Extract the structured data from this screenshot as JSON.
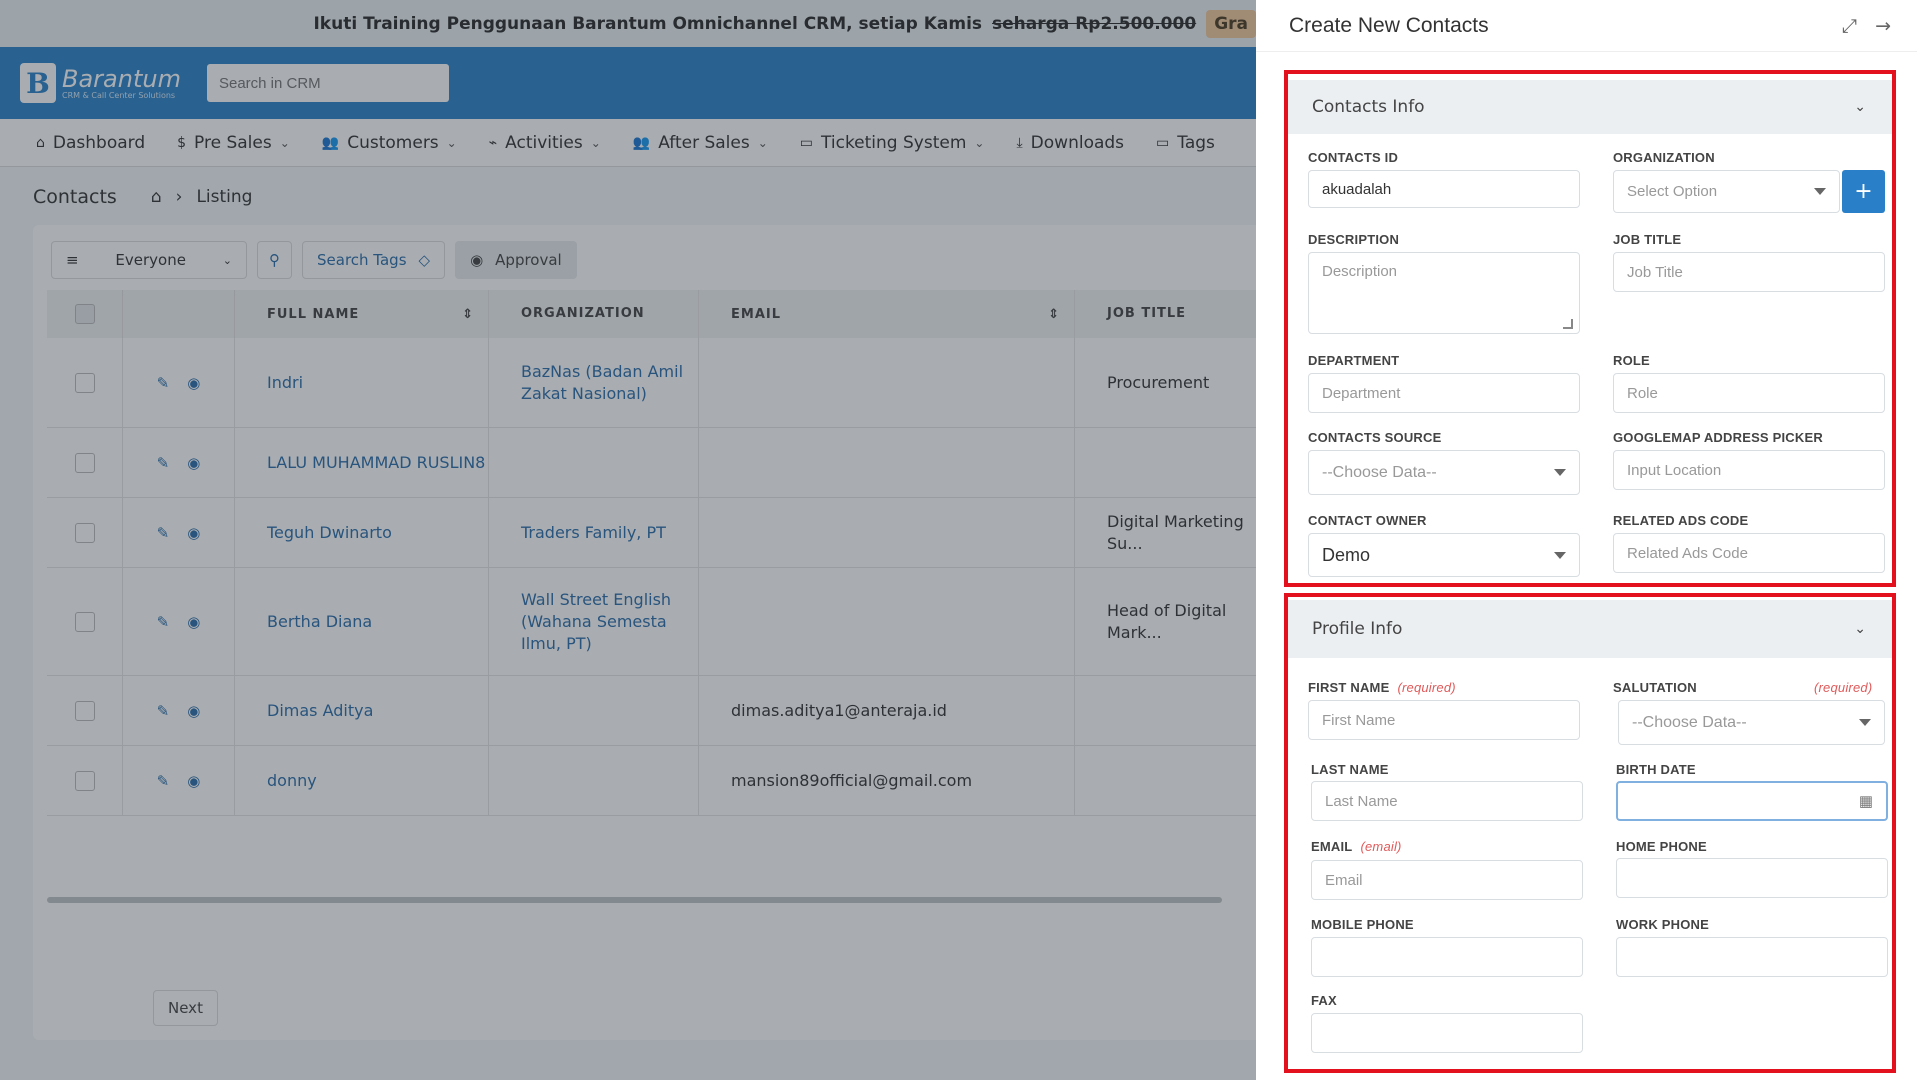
{
  "banner": {
    "text": "Ikuti Training Penggunaan Barantum Omnichannel CRM, setiap Kamis",
    "strike": "seharga Rp2.500.000",
    "badge": "Gra"
  },
  "header": {
    "brand": "Barantum",
    "tagline": "CRM & Call Center Solutions",
    "search_placeholder": "Search in CRM"
  },
  "nav": [
    {
      "label": "Dashboard",
      "icon": "home-icon",
      "glyph": "⌂",
      "chevron": false
    },
    {
      "label": "Pre Sales",
      "icon": "dollar-icon",
      "glyph": "$",
      "chevron": true
    },
    {
      "label": "Customers",
      "icon": "users-icon",
      "glyph": "👥",
      "chevron": true
    },
    {
      "label": "Activities",
      "icon": "activity-icon",
      "glyph": "⌁",
      "chevron": true
    },
    {
      "label": "After Sales",
      "icon": "users-icon",
      "glyph": "👥",
      "chevron": true
    },
    {
      "label": "Ticketing System",
      "icon": "folder-icon",
      "glyph": "▭",
      "chevron": true
    },
    {
      "label": "Downloads",
      "icon": "download-icon",
      "glyph": "⤓",
      "chevron": false
    },
    {
      "label": "Tags",
      "icon": "folder-icon",
      "glyph": "▭",
      "chevron": false
    }
  ],
  "breadcrumb": {
    "title": "Contacts",
    "sep": "›",
    "page": "Listing"
  },
  "toolbar": {
    "filter": "Everyone",
    "search_tags": "Search Tags",
    "approval": "Approval"
  },
  "table": {
    "headers": [
      "FULL NAME",
      "ORGANIZATION",
      "EMAIL",
      "JOB TITLE"
    ],
    "rows": [
      {
        "name": "Indri",
        "org": "BazNas (Badan Amil Zakat Nasional)",
        "email": "",
        "job": "Procurement"
      },
      {
        "name": "LALU MUHAMMAD RUSLIN8",
        "org": "",
        "email": "",
        "job": ""
      },
      {
        "name": "Teguh Dwinarto",
        "org": "Traders Family, PT",
        "email": "",
        "job": "Digital Marketing Su..."
      },
      {
        "name": "Bertha Diana",
        "org": "Wall Street English (Wahana Semesta Ilmu, PT)",
        "email": "",
        "job": "Head of Digital Mark..."
      },
      {
        "name": "Dimas Aditya",
        "org": "",
        "email": "dimas.aditya1@anteraja.id",
        "job": ""
      },
      {
        "name": "donny",
        "org": "",
        "email": "mansion89official@gmail.com",
        "job": ""
      }
    ]
  },
  "pager": {
    "next": "Next"
  },
  "panel": {
    "title": "Create New Contacts",
    "contacts_info": {
      "heading": "Contacts Info",
      "contacts_id_label": "CONTACTS ID",
      "contacts_id_value": "akuadalah",
      "organization_label": "ORGANIZATION",
      "organization_placeholder": "Select Option",
      "description_label": "DESCRIPTION",
      "description_placeholder": "Description",
      "job_title_label": "JOB TITLE",
      "job_title_placeholder": "Job Title",
      "department_label": "DEPARTMENT",
      "department_placeholder": "Department",
      "role_label": "ROLE",
      "role_placeholder": "Role",
      "contacts_source_label": "CONTACTS SOURCE",
      "contacts_source_value": "--Choose Data--",
      "googlemap_label": "GOOGLEMAP ADDRESS PICKER",
      "googlemap_placeholder": "Input Location",
      "contact_owner_label": "CONTACT OWNER",
      "contact_owner_value": "Demo",
      "related_ads_label": "RELATED ADS CODE",
      "related_ads_placeholder": "Related Ads Code"
    },
    "profile_info": {
      "heading": "Profile Info",
      "first_name_label": "FIRST NAME",
      "first_name_req": "(required)",
      "first_name_placeholder": "First Name",
      "salutation_label": "SALUTATION",
      "salutation_req": "(required)",
      "salutation_value": "--Choose Data--",
      "last_name_label": "LAST NAME",
      "last_name_placeholder": "Last Name",
      "birth_date_label": "BIRTH DATE",
      "email_label": "EMAIL",
      "email_req": "(email)",
      "email_placeholder": "Email",
      "home_phone_label": "HOME PHONE",
      "mobile_phone_label": "MOBILE PHONE",
      "work_phone_label": "WORK PHONE",
      "fax_label": "FAX"
    }
  },
  "colors": {
    "primary": "#2a80c8",
    "highlight": "#e3101e",
    "required": "#e05a5a"
  }
}
